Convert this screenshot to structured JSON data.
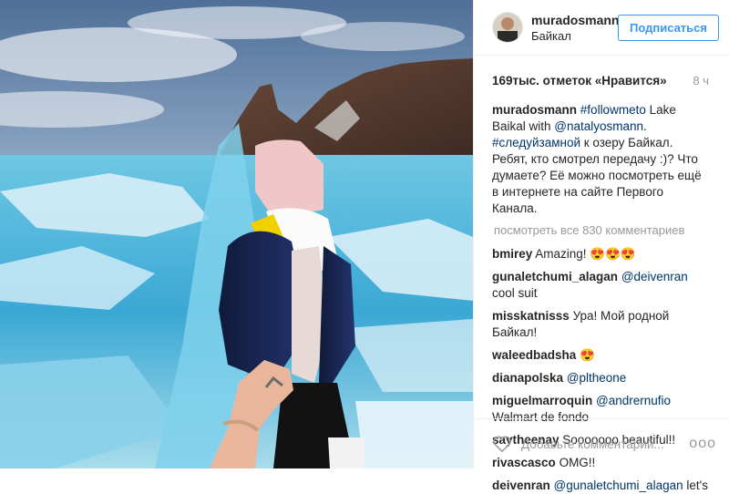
{
  "header": {
    "username": "muradosmann",
    "location": "Байкал",
    "follow_label": "Подписаться"
  },
  "stats": {
    "likes": "169тыс. отметок «Нравится»",
    "time": "8 ч"
  },
  "caption": {
    "username": "muradosmann",
    "hashtag1": "#followmeto",
    "text1": " Lake Baikal with ",
    "mention": "@natalyosmann",
    "text2": ". ",
    "hashtag2": "#следуйзамной",
    "text3": " к озеру Байкал. Ребят, кто смотрел передачу :)? Что думаете? Её можно посмотреть ещё в интернете на сайте Первого Канала."
  },
  "view_all": "посмотреть все 830 комментариев",
  "comments": [
    {
      "user": "bmirey",
      "text": " Amazing! 😍😍😍"
    },
    {
      "user": "gunaletchumi_alagan",
      "mention": "@deivenran",
      "text": " cool suit"
    },
    {
      "user": "misskatnisss",
      "text": " Ура! Мой родной Байкал!"
    },
    {
      "user": "waleedbadsha",
      "text": " 😍"
    },
    {
      "user": "dianapolska",
      "mention": "@pltheone",
      "text": ""
    },
    {
      "user": "miguelmarroquin",
      "mention": "@andrernufio",
      "text": " Walmart de fondo"
    },
    {
      "user": "saytheenay",
      "text": " Sooooooo beautiful!!"
    },
    {
      "user": "rivascasco",
      "text": " OMG!!"
    },
    {
      "user": "deivenran",
      "mention": "@gunaletchumi_alagan",
      "text": " let's"
    }
  ],
  "footer": {
    "placeholder": "Добавьте комментарий...",
    "more": "ooo"
  },
  "colors": {
    "accent": "#3897f0",
    "link": "#003569",
    "muted": "#999999"
  }
}
